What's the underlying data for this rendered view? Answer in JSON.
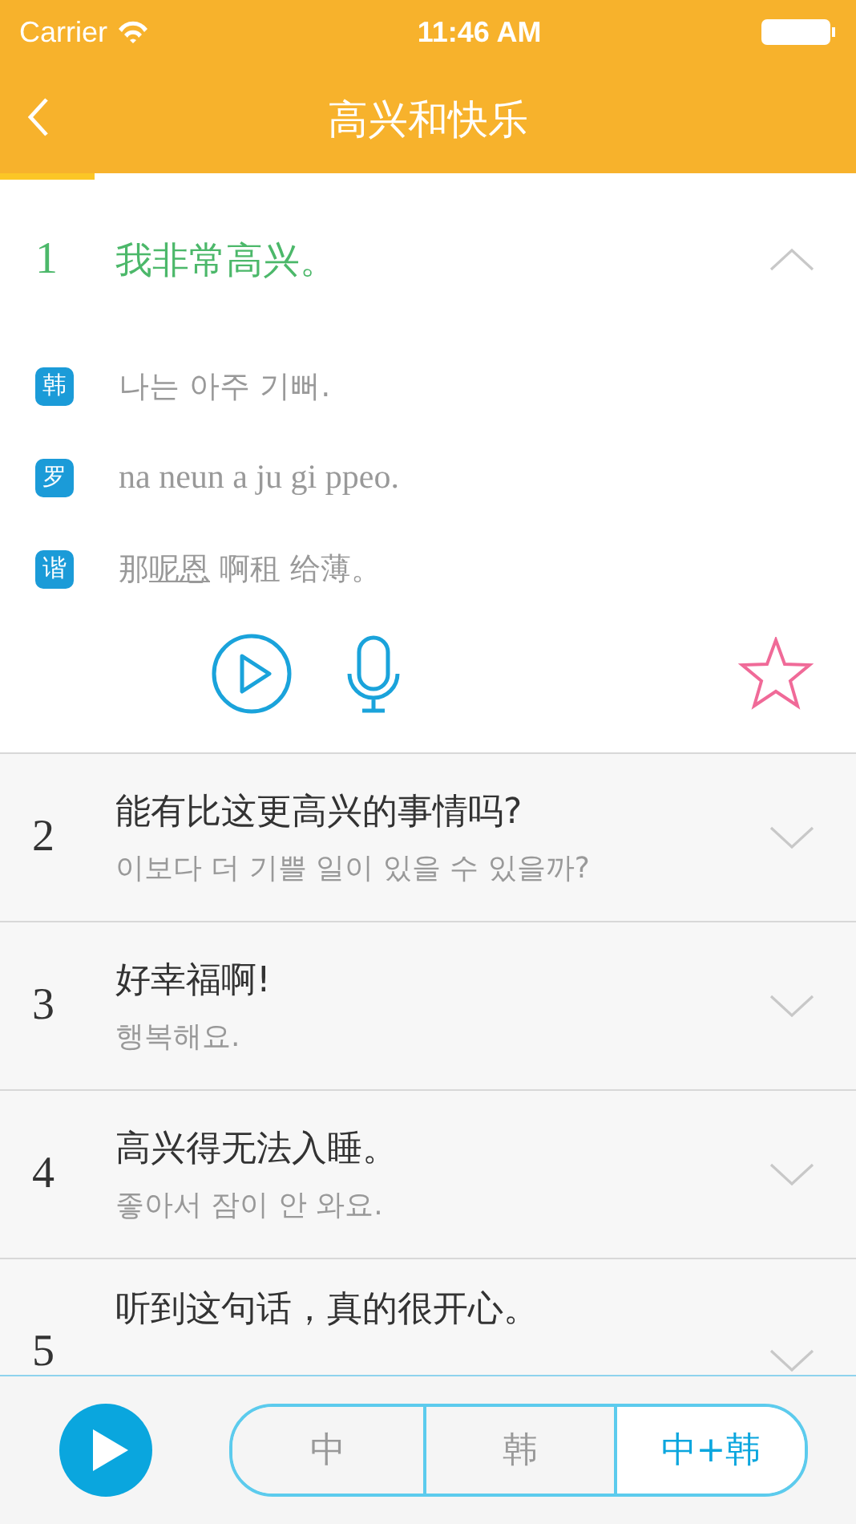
{
  "status_bar": {
    "carrier": "Carrier",
    "time": "11:46 AM"
  },
  "nav": {
    "title": "高兴和快乐"
  },
  "progress": {
    "level": 0.11
  },
  "expanded": {
    "number": "1",
    "sentence": "我非常高兴。",
    "favorite": false,
    "lines": [
      {
        "tag": "韩",
        "parts": [
          {
            "text": "나는 아주 기뻐.",
            "underlined": false
          }
        ],
        "kind": "hangul"
      },
      {
        "tag": "罗",
        "parts": [
          {
            "text": "na neun a ju gi ppeo.",
            "underlined": false
          }
        ],
        "kind": "roman"
      },
      {
        "tag": "谐",
        "parts": [
          {
            "text": "那",
            "underlined": false
          },
          {
            "text": "呢恩",
            "underlined": true
          },
          {
            "text": " 啊租 给薄。",
            "underlined": false
          }
        ],
        "kind": "hangul"
      }
    ]
  },
  "rows": [
    {
      "number": "2",
      "sentence": "能有比这更高兴的事情吗?",
      "translation": "이보다 더 기쁠 일이 있을 수 있을까?"
    },
    {
      "number": "3",
      "sentence": "好幸福啊!",
      "translation": "행복해요."
    },
    {
      "number": "4",
      "sentence": "高兴得无法入睡。",
      "translation": "좋아서 잠이 안 와요."
    },
    {
      "number": "5",
      "sentence": "听到这句话，真的很开心。"
    }
  ],
  "modes": [
    {
      "label": "中",
      "selected": false
    },
    {
      "label": "韩",
      "selected": false
    },
    {
      "label": "中+韩",
      "selected": true
    }
  ]
}
